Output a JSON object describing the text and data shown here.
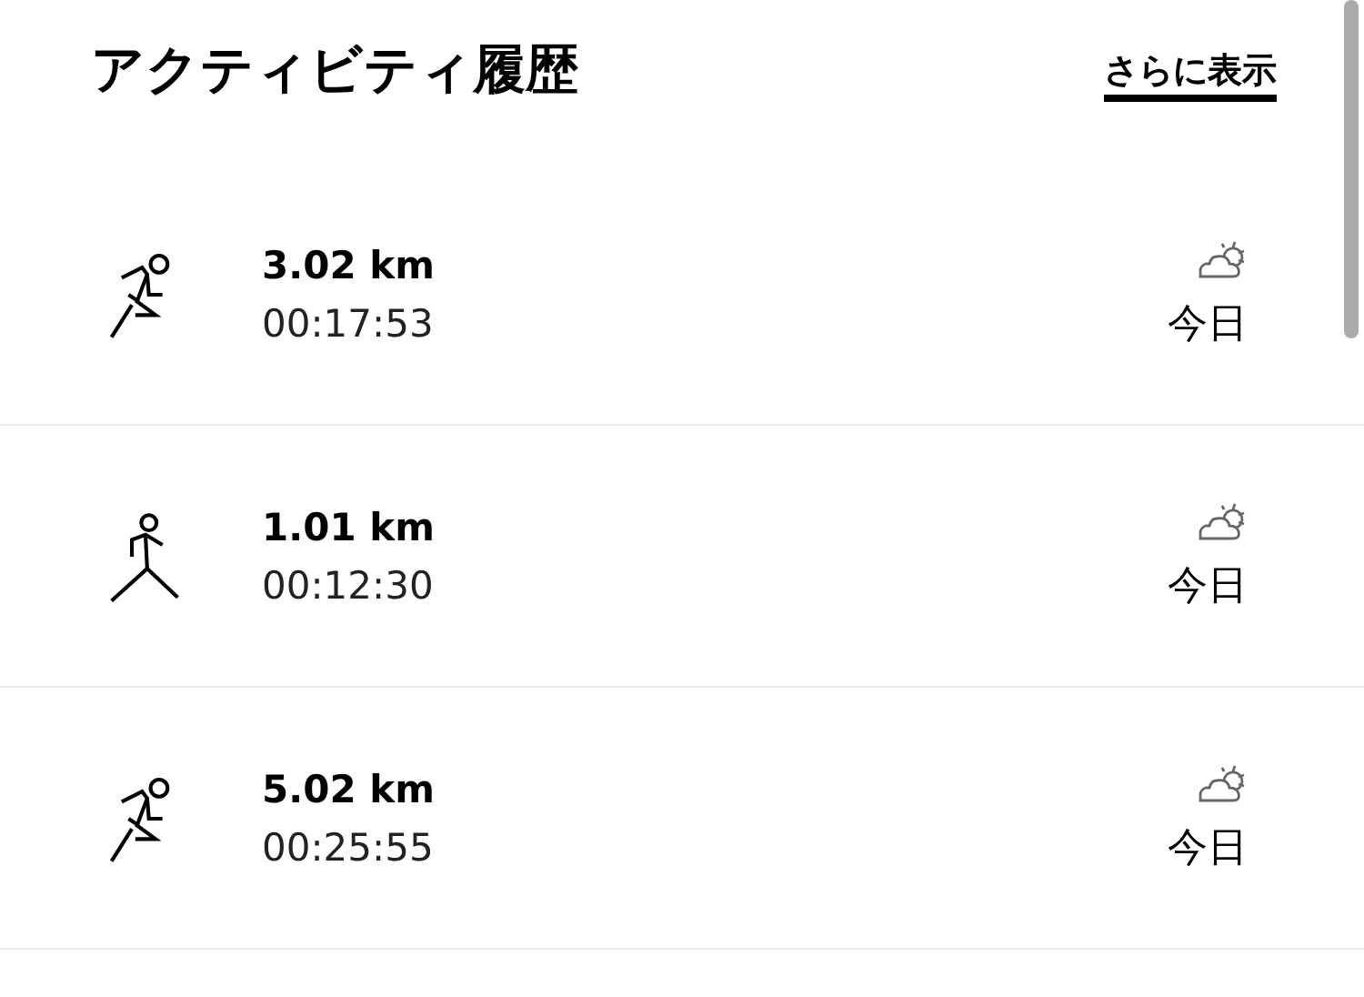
{
  "header": {
    "title": "アクティビティ履歴",
    "more_link": "さらに表示"
  },
  "activities": [
    {
      "kind": "run",
      "distance": "3.02 km",
      "duration": "00:17:53",
      "date": "今日"
    },
    {
      "kind": "walk",
      "distance": "1.01 km",
      "duration": "00:12:30",
      "date": "今日"
    },
    {
      "kind": "run",
      "distance": "5.02 km",
      "duration": "00:25:55",
      "date": "今日"
    }
  ]
}
